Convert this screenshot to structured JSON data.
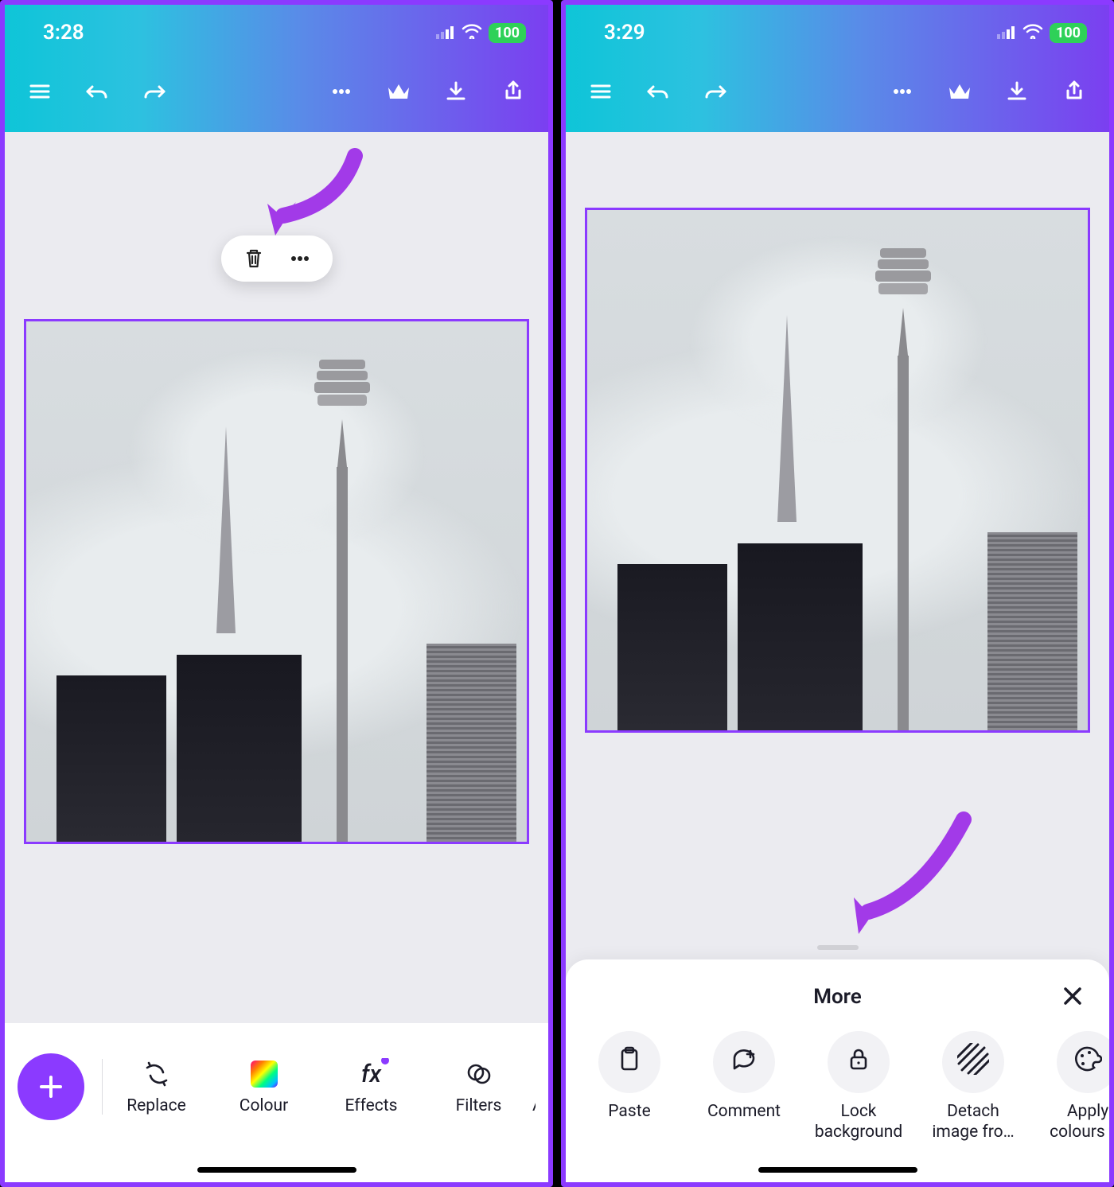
{
  "left": {
    "status": {
      "time": "3:28",
      "battery": "100"
    },
    "bottom_items": [
      {
        "label": "Replace"
      },
      {
        "label": "Colour"
      },
      {
        "label": "Effects"
      },
      {
        "label": "Filters"
      },
      {
        "label": "A"
      }
    ]
  },
  "right": {
    "status": {
      "time": "3:29",
      "battery": "100"
    },
    "sheet": {
      "title": "More",
      "items": [
        {
          "label": "Paste"
        },
        {
          "label": "Comment"
        },
        {
          "label2a": "Lock",
          "label2b": "background"
        },
        {
          "label2a": "Detach",
          "label2b": "image fro…"
        },
        {
          "label2a": "Apply",
          "label2b": "colours t…"
        }
      ]
    }
  }
}
